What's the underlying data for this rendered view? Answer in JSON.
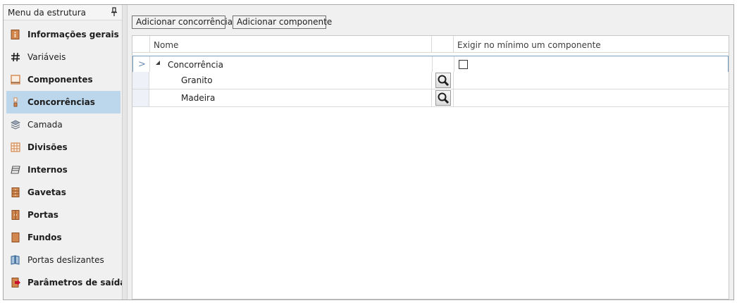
{
  "sidebar": {
    "title": "Menu da estrutura",
    "items": [
      {
        "label": "Informações gerais",
        "bold": true,
        "icon": "info-panel-icon"
      },
      {
        "label": "Variáveis",
        "bold": false,
        "icon": "hash-icon"
      },
      {
        "label": "Componentes",
        "bold": true,
        "icon": "component-icon"
      },
      {
        "label": "Concorrências",
        "bold": false,
        "icon": "concurrence-icon",
        "active": true
      },
      {
        "label": "Camada",
        "bold": false,
        "icon": "layers-icon"
      },
      {
        "label": "Divisões",
        "bold": true,
        "icon": "divisions-icon"
      },
      {
        "label": "Internos",
        "bold": true,
        "icon": "internals-icon"
      },
      {
        "label": "Gavetas",
        "bold": true,
        "icon": "drawers-icon"
      },
      {
        "label": "Portas",
        "bold": true,
        "icon": "door-icon"
      },
      {
        "label": "Fundos",
        "bold": true,
        "icon": "back-panel-icon"
      },
      {
        "label": "Portas deslizantes",
        "bold": false,
        "icon": "sliding-door-icon"
      },
      {
        "label": "Parâmetros de saída",
        "bold": true,
        "icon": "output-params-icon"
      }
    ]
  },
  "toolbar": {
    "add_concurrence": "Adicionar concorrência",
    "add_component": "Adicionar componente"
  },
  "grid": {
    "columns": {
      "name": "Nome",
      "require_min": "Exigir no mínimo um componente"
    },
    "rows": [
      {
        "name": "Concorrência",
        "type": "group",
        "checked": false,
        "selected": true
      },
      {
        "name": "Granito",
        "type": "child"
      },
      {
        "name": "Madeira",
        "type": "child"
      }
    ]
  },
  "colors": {
    "active_item": "#bcd6ec",
    "row_header": "#eef2f8",
    "panel_bg": "#f0f0f0",
    "orange_icon": "#d2874e"
  }
}
